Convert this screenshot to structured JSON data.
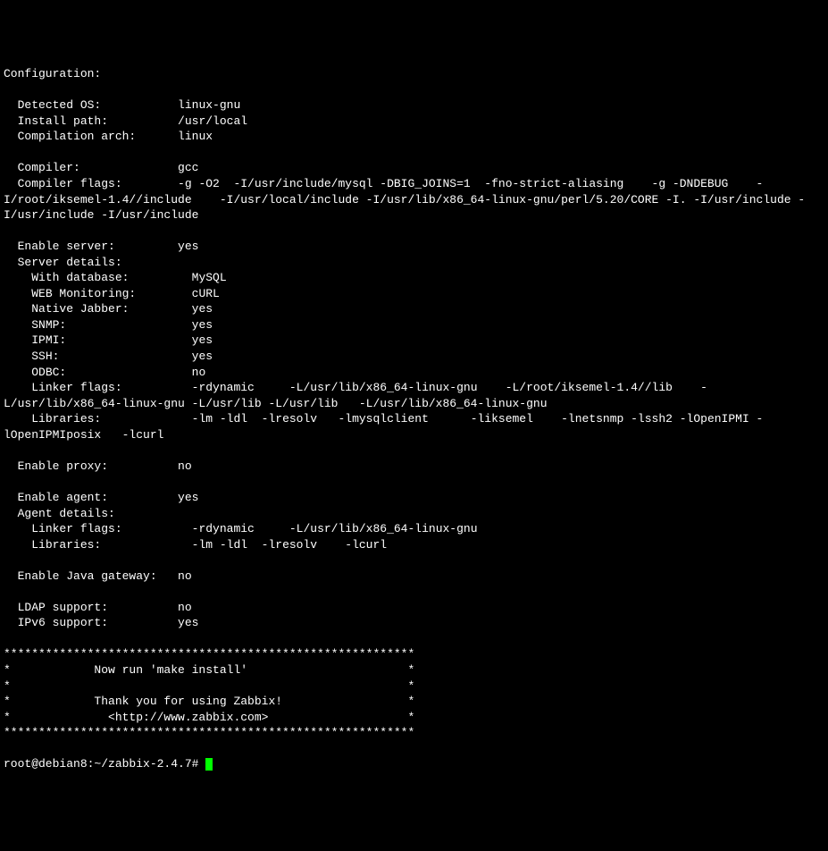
{
  "header": "Configuration:",
  "lines": [
    "",
    "  Detected OS:           linux-gnu",
    "  Install path:          /usr/local",
    "  Compilation arch:      linux",
    "",
    "  Compiler:              gcc",
    "  Compiler flags:        -g -O2  -I/usr/include/mysql -DBIG_JOINS=1  -fno-strict-aliasing    -g -DNDEBUG    -I/root/iksemel-1.4//include    -I/usr/local/include -I/usr/lib/x86_64-linux-gnu/perl/5.20/CORE -I. -I/usr/include -I/usr/include -I/usr/include",
    "",
    "  Enable server:         yes",
    "  Server details:",
    "    With database:         MySQL",
    "    WEB Monitoring:        cURL",
    "    Native Jabber:         yes",
    "    SNMP:                  yes",
    "    IPMI:                  yes",
    "    SSH:                   yes",
    "    ODBC:                  no",
    "    Linker flags:          -rdynamic     -L/usr/lib/x86_64-linux-gnu    -L/root/iksemel-1.4//lib    -L/usr/lib/x86_64-linux-gnu -L/usr/lib -L/usr/lib   -L/usr/lib/x86_64-linux-gnu",
    "    Libraries:             -lm -ldl  -lresolv   -lmysqlclient      -liksemel    -lnetsnmp -lssh2 -lOpenIPMI -lOpenIPMIposix   -lcurl",
    "",
    "  Enable proxy:          no",
    "",
    "  Enable agent:          yes",
    "  Agent details:",
    "    Linker flags:          -rdynamic     -L/usr/lib/x86_64-linux-gnu",
    "    Libraries:             -lm -ldl  -lresolv    -lcurl",
    "",
    "  Enable Java gateway:   no",
    "",
    "  LDAP support:          no",
    "  IPv6 support:          yes",
    "",
    "***********************************************************",
    "*            Now run 'make install'                       *",
    "*                                                         *",
    "*            Thank you for using Zabbix!                  *",
    "*              <http://www.zabbix.com>                    *",
    "***********************************************************",
    ""
  ],
  "prompt": "root@debian8:~/zabbix-2.4.7# "
}
